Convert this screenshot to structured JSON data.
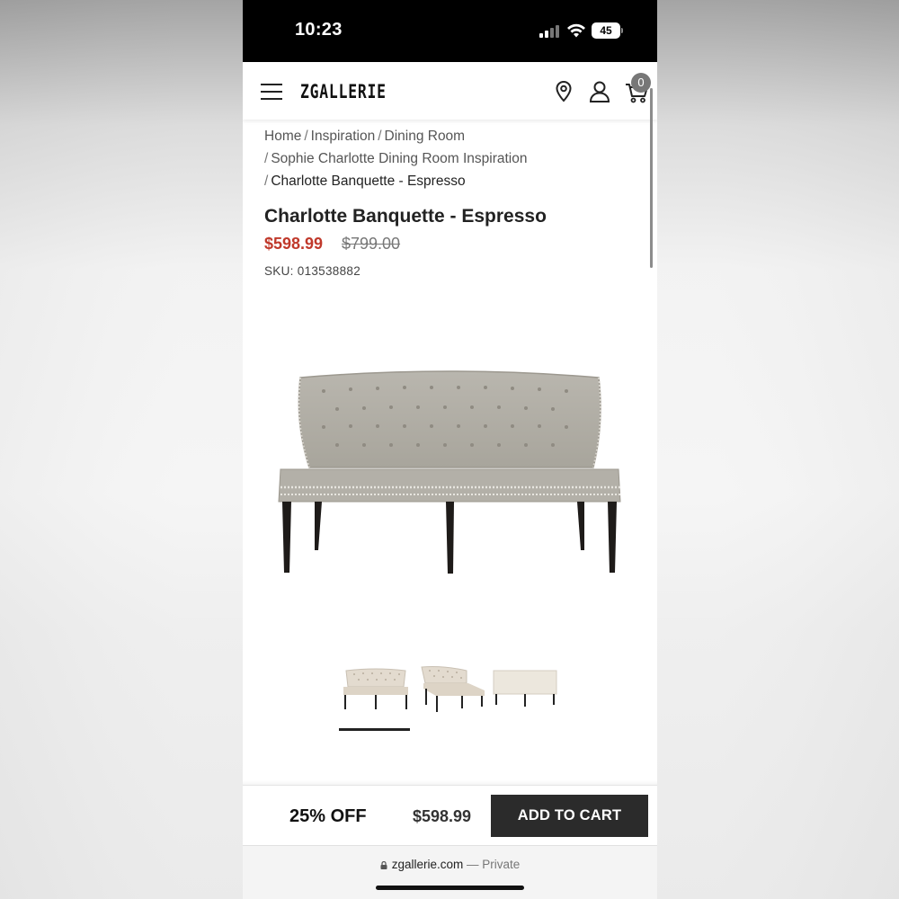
{
  "status_bar": {
    "time": "10:23",
    "battery": "45"
  },
  "header": {
    "logo": "ZGALLERIE",
    "menu_icon": "hamburger-menu-icon",
    "location_icon": "map-pin-icon",
    "account_icon": "user-icon",
    "cart_icon": "shopping-cart-icon",
    "cart_count": "0"
  },
  "breadcrumb": {
    "home": "Home",
    "inspiration": "Inspiration",
    "dining_room": "Dining Room",
    "collection": "Sophie Charlotte Dining Room Inspiration",
    "current": "Charlotte Banquette - Espresso",
    "separator": "/"
  },
  "product": {
    "title": "Charlotte Banquette - Espresso",
    "sale_price": "$598.99",
    "original_price": "$799.00",
    "sku": "SKU: 013538882",
    "thumbnails_count": 3,
    "selected_thumbnail": 0
  },
  "sticky_bar": {
    "discount": "25% OFF",
    "price": "$598.99",
    "add_to_cart": "ADD TO CART"
  },
  "browser": {
    "domain": "zgallerie.com",
    "separator": "—",
    "mode": "Private"
  },
  "colors": {
    "sale_price": "#c0392b",
    "button_bg": "#2b2b2b",
    "badge_bg": "#777777"
  }
}
